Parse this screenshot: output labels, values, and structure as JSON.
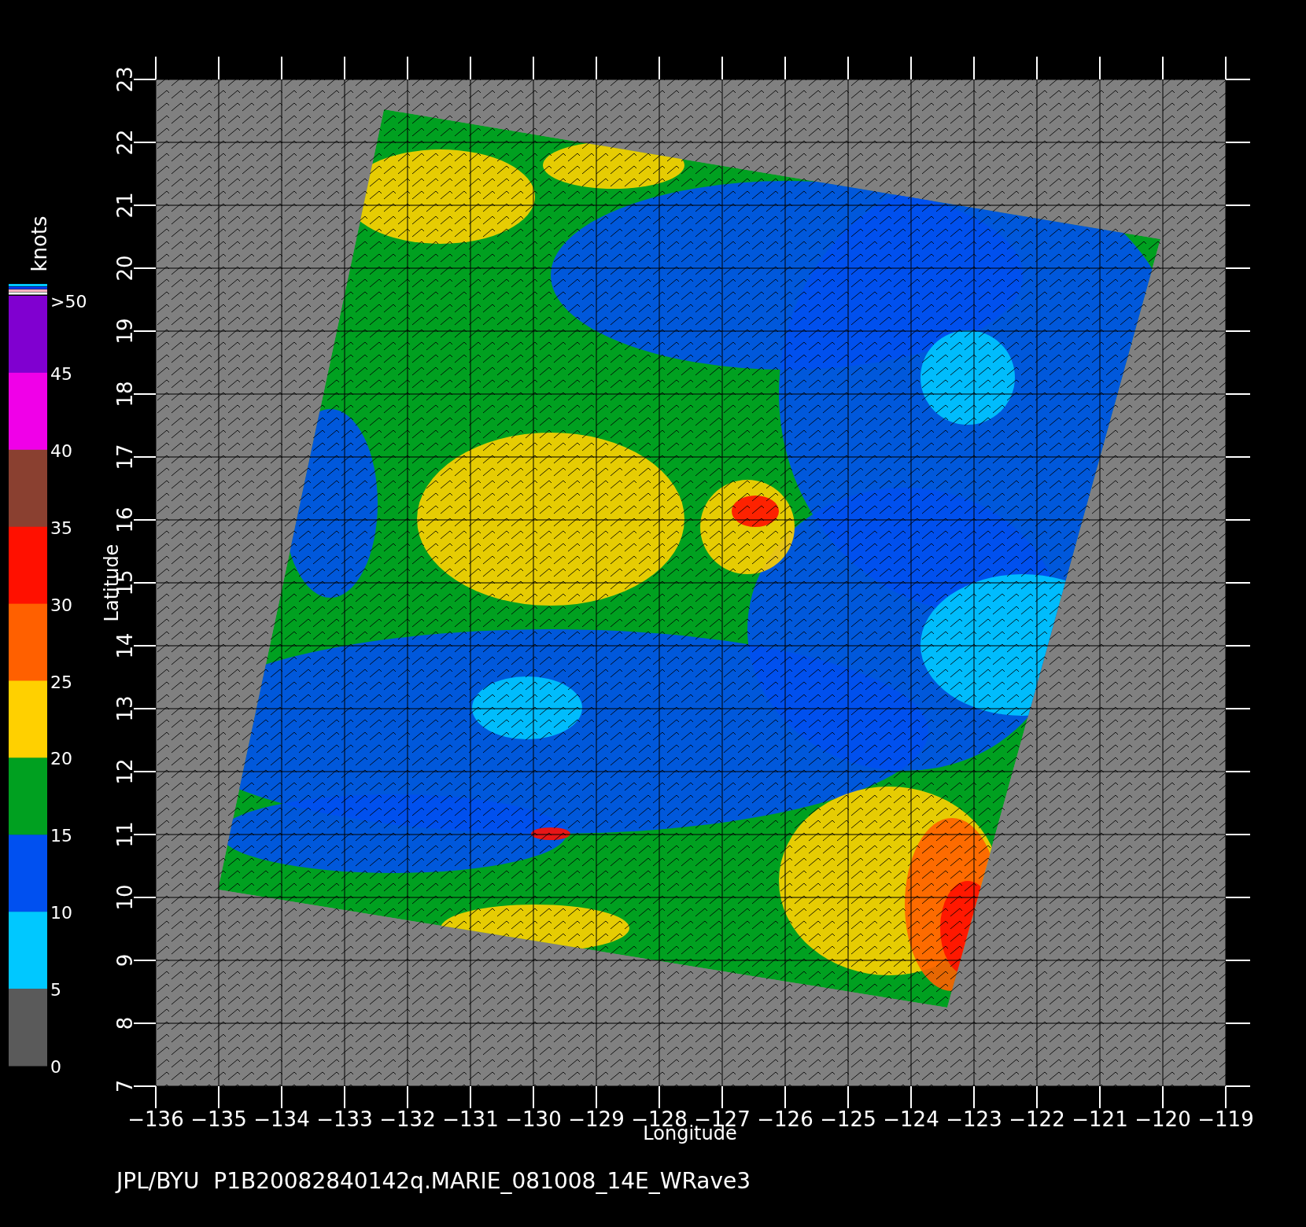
{
  "title": "JPL/BYU  P1B20082840142q.MARIE_081008_14E_WRave3",
  "colorbar": {
    "unit": "knots",
    "top_label": ">50",
    "overflow_colors": [
      {
        "color": "#00c8ff"
      },
      {
        "color": "#0040ff"
      },
      {
        "color": "#ffb0c0"
      },
      {
        "color": "#ffffff"
      }
    ],
    "bands": [
      {
        "label": "45",
        "color": "#8000d0"
      },
      {
        "label": "40",
        "color": "#f000e8"
      },
      {
        "label": "35",
        "color": "#8a4030"
      },
      {
        "label": "30",
        "color": "#ff1000"
      },
      {
        "label": "25",
        "color": "#ff6000"
      },
      {
        "label": "20",
        "color": "#ffd000"
      },
      {
        "label": "15",
        "color": "#00a020"
      },
      {
        "label": "10",
        "color": "#0050f0"
      },
      {
        "label": "5",
        "color": "#00c8ff"
      },
      {
        "label": "0",
        "color": "#5a5a5a"
      }
    ]
  },
  "map": {
    "x_axis": {
      "label": "Longitude",
      "ticks": [
        "−136",
        "−135",
        "−134",
        "−133",
        "−132",
        "−131",
        "−130",
        "−129",
        "−128",
        "−127",
        "−126",
        "−125",
        "−124",
        "−123",
        "−122",
        "−121",
        "−120",
        "−119"
      ]
    },
    "y_axis": {
      "label": "Latitude",
      "ticks": [
        "7",
        "8",
        "9",
        "10",
        "11",
        "12",
        "13",
        "14",
        "15",
        "16",
        "17",
        "18",
        "19",
        "20",
        "21",
        "22",
        "23"
      ]
    }
  }
}
